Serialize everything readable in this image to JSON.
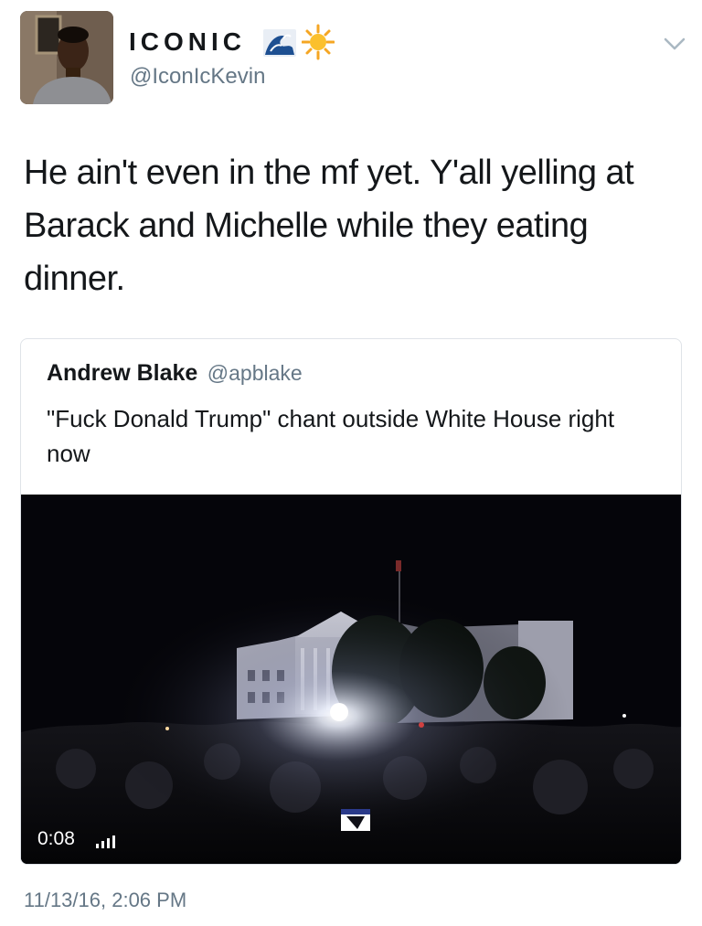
{
  "tweet": {
    "author": {
      "display_name": "ICONIC",
      "name_emojis": [
        "wave-emoji",
        "sun-emoji"
      ],
      "handle": "@IconIcKevin",
      "avatar_icon": "profile-photo"
    },
    "menu_icon": "chevron-down-icon",
    "text": "He ain't even in the mf yet. Y'all yelling at Barack and Michelle while they eating dinner.",
    "timestamp": "11/13/16, 2:06 PM"
  },
  "quoted_tweet": {
    "author_name": "Andrew Blake",
    "author_handle": "@apblake",
    "text": "\"Fuck Donald Trump\" chant outside White House right now",
    "media": {
      "type": "video",
      "duration": "0:08",
      "audio_icon": "volume-bars-icon"
    }
  },
  "colors": {
    "text_primary": "#14171a",
    "text_secondary": "#657786",
    "border": "#dfe3e8",
    "video_bg": "#05050a"
  }
}
